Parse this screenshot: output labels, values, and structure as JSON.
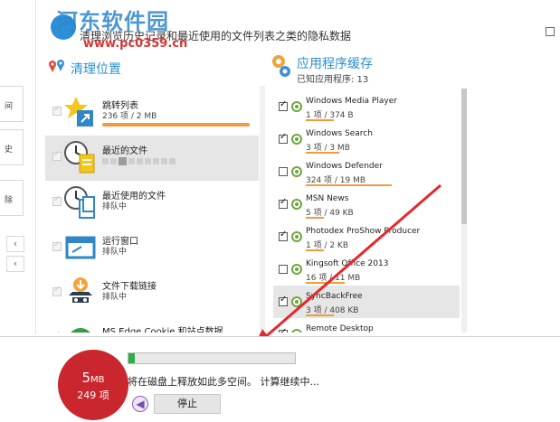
{
  "header": {
    "watermark_title": "河东软件园",
    "watermark_url": "www.pc0359.cn",
    "description": "清理浏览历史记录和最近使用的文件列表之类的隐私数据"
  },
  "left_strip": {
    "boxes": [
      "间",
      "史",
      "除"
    ],
    "arrows": [
      "‹",
      "‹"
    ]
  },
  "locations": {
    "title": "清理位置",
    "items": [
      {
        "name": "跳转列表",
        "status": "236 项 / 2 MB",
        "bar": true
      },
      {
        "name": "最近的文件",
        "status": "",
        "dots": true,
        "selected": true
      },
      {
        "name": "最近使用的文件",
        "status": "排队中"
      },
      {
        "name": "运行窗口",
        "status": "排队中"
      },
      {
        "name": "文件下载链接",
        "status": "排队中"
      },
      {
        "name": "MS Edge Cookie 和站点数据",
        "status": ""
      }
    ]
  },
  "apps": {
    "title": "应用程序缓存",
    "subtitle": "已知应用程序: 13",
    "items": [
      {
        "name": "Windows Media Player",
        "size": "1 项 / 374 B",
        "checked": true,
        "bar": 0.18
      },
      {
        "name": "Windows Search",
        "size": "3 项 / 3 MB",
        "checked": true,
        "bar": 0.22
      },
      {
        "name": "Windows Defender",
        "size": "324 项 / 19 MB",
        "checked": false,
        "bar": 0.56
      },
      {
        "name": "MSN News",
        "size": "5 项 / 49 KB",
        "checked": true,
        "bar": 0.12
      },
      {
        "name": "Photodex ProShow Producer",
        "size": "1 项 / 2 KB",
        "checked": true,
        "bar": 0.12
      },
      {
        "name": "Kingsoft Office 2013",
        "size": "16 项 / 11 MB",
        "checked": false,
        "bar": 0.25
      },
      {
        "name": "SyncBackFree",
        "size": "3 项 / 408 KB",
        "checked": true,
        "bar": 0.18,
        "highlight": true
      },
      {
        "name": "Remote Desktop",
        "size": "",
        "checked": true,
        "bar": 0
      }
    ]
  },
  "footer": {
    "size_mb": "5",
    "size_unit": "MB",
    "count": "249 项",
    "progress": 0.04,
    "message": "将在磁盘上释放如此多空间。 计算继续中...",
    "back_icon": "back-arrow-icon",
    "stop_label": "停止"
  },
  "colors": {
    "accent_blue": "#2a8fd0",
    "accent_orange": "#f39a3c",
    "ring_red": "#c9272d",
    "progress_green": "#2fae45",
    "annotation_red": "#e8272c"
  }
}
